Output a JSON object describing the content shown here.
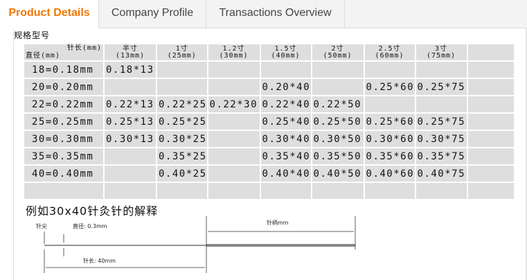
{
  "tabs": [
    {
      "label": "Product Details"
    },
    {
      "label": "Company Profile"
    },
    {
      "label": "Transactions Overview"
    }
  ],
  "spec": {
    "title": "规格型号",
    "corner_length": "针长(mm)",
    "corner_diameter": "直径(mm)",
    "columns": [
      {
        "name": "半寸",
        "sub": "(13mm)"
      },
      {
        "name": "1寸",
        "sub": "(25mm)"
      },
      {
        "name": "1.2寸",
        "sub": "(30mm)"
      },
      {
        "name": "1.5寸",
        "sub": "(40mm)"
      },
      {
        "name": "2寸",
        "sub": "(50mm)"
      },
      {
        "name": "2.5寸",
        "sub": "(60mm)"
      },
      {
        "name": "3寸",
        "sub": "(75mm)"
      }
    ],
    "rows": [
      {
        "label": "18=0.18mm",
        "cells": [
          "0.18*13",
          "",
          "",
          "",
          "",
          "",
          "",
          ""
        ]
      },
      {
        "label": "20=0.20mm",
        "cells": [
          "",
          "",
          "",
          "0.20*40",
          "",
          "0.25*60",
          "0.25*75",
          ""
        ]
      },
      {
        "label": "22=0.22mm",
        "cells": [
          "0.22*13",
          "0.22*25",
          "0.22*30",
          "0.22*40",
          "0.22*50",
          "",
          "",
          ""
        ]
      },
      {
        "label": "25=0.25mm",
        "cells": [
          "0.25*13",
          "0.25*25",
          "",
          "0.25*40",
          "0.25*50",
          "0.25*60",
          "0.25*75",
          ""
        ]
      },
      {
        "label": "30=0.30mm",
        "cells": [
          "0.30*13",
          "0.30*25",
          "",
          "0.30*40",
          "0.30*50",
          "0.30*60",
          "0.30*75",
          ""
        ]
      },
      {
        "label": "35=0.35mm",
        "cells": [
          "",
          "0.35*25",
          "",
          "0.35*40",
          "0.35*50",
          "0.35*60",
          "0.35*75",
          ""
        ]
      },
      {
        "label": "40=0.40mm",
        "cells": [
          "",
          "0.40*25",
          "",
          "0.40*40",
          "0.40*50",
          "0.40*60",
          "0.40*75",
          ""
        ]
      },
      {
        "label": "",
        "cells": [
          "",
          "",
          "",
          "",
          "",
          "",
          "",
          ""
        ]
      }
    ]
  },
  "example": {
    "title": "例如30x40针灸针的解释",
    "tip_label": "针尖",
    "diameter_label": "直径: 0.3mm",
    "handle_label": "针柄mm",
    "length_label": "针长: 40mm"
  },
  "colors": {
    "active_tab": "#f07800",
    "table_cell": "#dedede"
  }
}
